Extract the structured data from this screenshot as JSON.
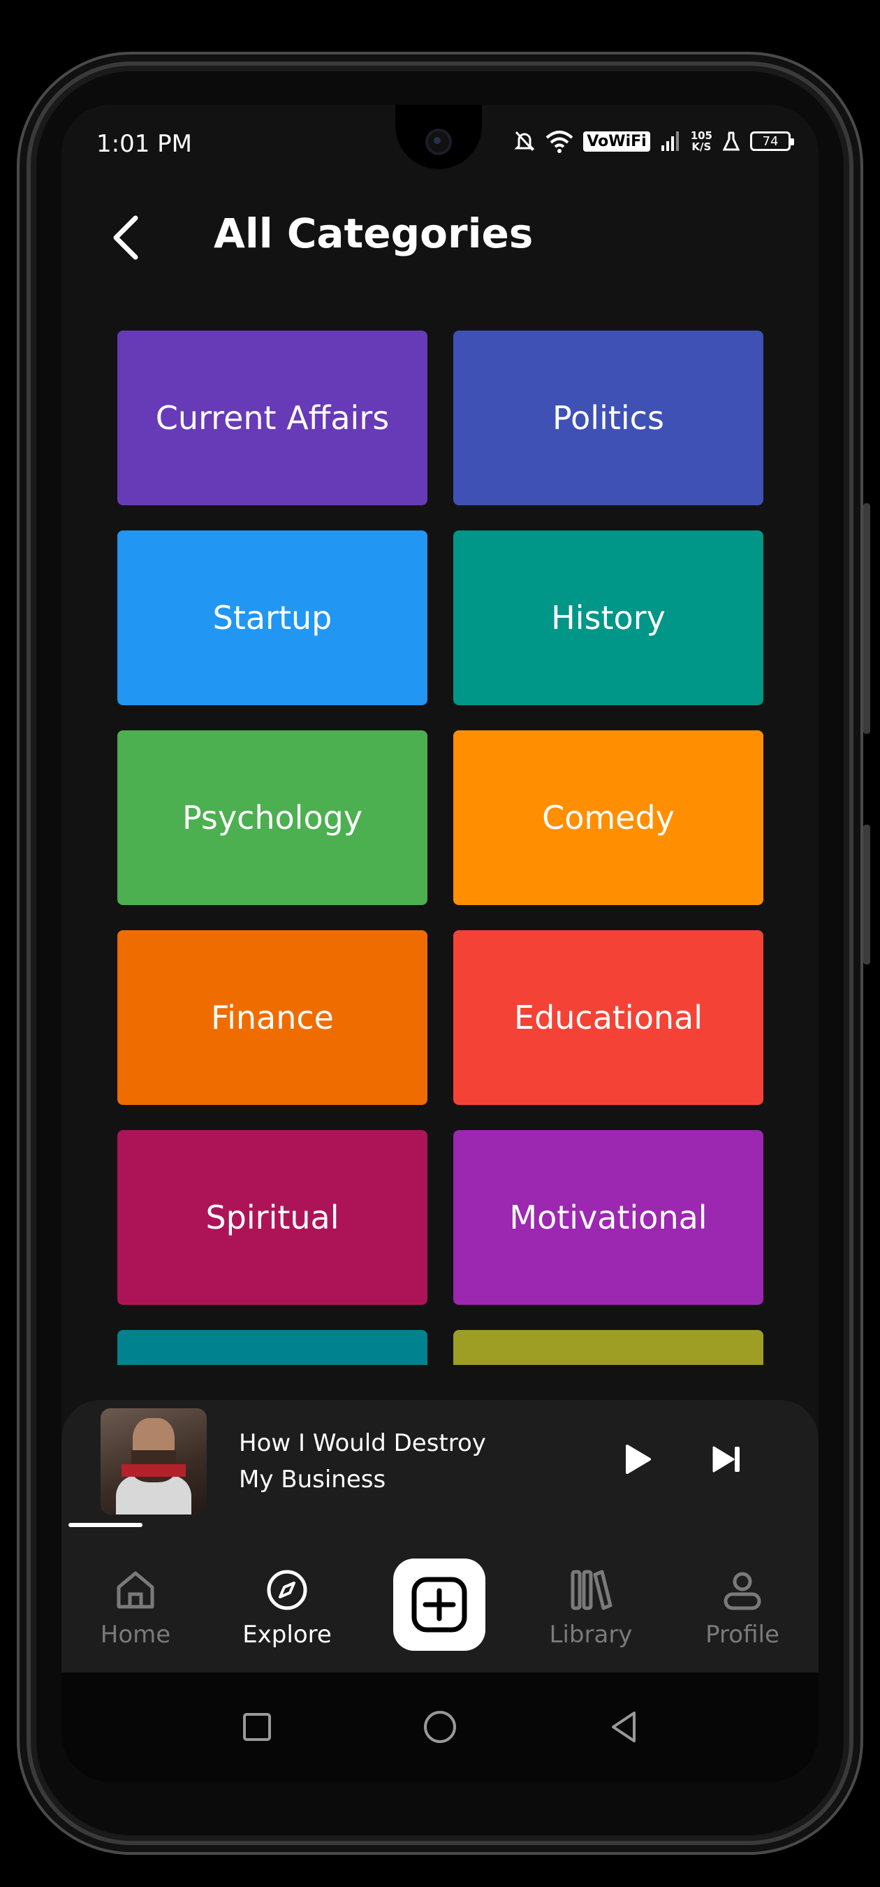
{
  "status_bar": {
    "time": "1:01 PM",
    "vowifi": "VoWiFi",
    "speed_value": "105",
    "speed_unit": "K/S",
    "battery": "74"
  },
  "header": {
    "title": "All Categories"
  },
  "categories": [
    {
      "label": "Current Affairs",
      "color": "#673AB7"
    },
    {
      "label": "Politics",
      "color": "#3F51B5"
    },
    {
      "label": "Startup",
      "color": "#2196F3"
    },
    {
      "label": "History",
      "color": "#009688"
    },
    {
      "label": "Psychology",
      "color": "#4CAF50"
    },
    {
      "label": "Comedy",
      "color": "#FF8F00"
    },
    {
      "label": "Finance",
      "color": "#EF6C00"
    },
    {
      "label": "Educational",
      "color": "#F44336"
    },
    {
      "label": "Spiritual",
      "color": "#AD1457"
    },
    {
      "label": "Motivational",
      "color": "#9C27B0"
    },
    {
      "label": "",
      "color": "#00838F"
    },
    {
      "label": "",
      "color": "#9E9D24"
    }
  ],
  "mini_player": {
    "title_line1": "How I Would Destroy",
    "title_line2": "My Business",
    "progress": 0.06
  },
  "nav": {
    "home": "Home",
    "explore": "Explore",
    "library": "Library",
    "profile": "Profile",
    "active": "explore"
  },
  "colors": {
    "background": "#121212",
    "panel": "#1d1d1d",
    "inactive": "#7a7a7a"
  }
}
